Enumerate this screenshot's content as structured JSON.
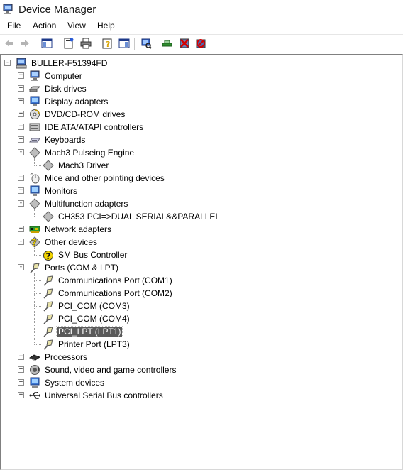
{
  "window": {
    "title": "Device Manager",
    "icon": "device-manager-icon"
  },
  "menu": [
    "File",
    "Action",
    "View",
    "Help"
  ],
  "toolbar": [
    "back-arrow-icon",
    "forward-arrow-icon",
    "show-hide-console-tree-icon",
    "properties-icon",
    "print-icon",
    "help-icon",
    "show-hide-action-pane-icon",
    "scan-hardware-icon",
    "update-driver-icon",
    "disable-device-icon",
    "uninstall-device-icon"
  ],
  "tree": {
    "root": "BULLER-F51394FD",
    "nodes": [
      {
        "label": "Computer",
        "icon": "computer-icon",
        "level": 1,
        "expander": "+"
      },
      {
        "label": "Disk drives",
        "icon": "disk-drive-icon",
        "level": 1,
        "expander": "+"
      },
      {
        "label": "Display adapters",
        "icon": "monitor-icon",
        "level": 1,
        "expander": "+"
      },
      {
        "label": "DVD/CD-ROM drives",
        "icon": "cdrom-icon",
        "level": 1,
        "expander": "+"
      },
      {
        "label": "IDE ATA/ATAPI controllers",
        "icon": "ide-controller-icon",
        "level": 1,
        "expander": "+"
      },
      {
        "label": "Keyboards",
        "icon": "keyboard-icon",
        "level": 1,
        "expander": "+"
      },
      {
        "label": "Mach3 Pulseing Engine",
        "icon": "generic-device-icon",
        "level": 1,
        "expander": "-"
      },
      {
        "label": "Mach3 Driver",
        "icon": "generic-device-icon",
        "level": 2
      },
      {
        "label": "Mice and other pointing devices",
        "icon": "mouse-icon",
        "level": 1,
        "expander": "+"
      },
      {
        "label": "Monitors",
        "icon": "monitor-icon",
        "level": 1,
        "expander": "+"
      },
      {
        "label": "Multifunction adapters",
        "icon": "generic-device-icon",
        "level": 1,
        "expander": "-"
      },
      {
        "label": "CH353 PCI=>DUAL SERIAL&&PARALLEL",
        "icon": "generic-device-icon",
        "level": 2
      },
      {
        "label": "Network adapters",
        "icon": "network-adapter-icon",
        "level": 1,
        "expander": "+"
      },
      {
        "label": "Other devices",
        "icon": "unknown-device-icon",
        "level": 1,
        "expander": "-"
      },
      {
        "label": "SM Bus Controller",
        "icon": "unknown-device-icon",
        "level": 2
      },
      {
        "label": "Ports (COM & LPT)",
        "icon": "port-icon",
        "level": 1,
        "expander": "-"
      },
      {
        "label": "Communications Port (COM1)",
        "icon": "port-icon",
        "level": 2
      },
      {
        "label": "Communications Port (COM2)",
        "icon": "port-icon",
        "level": 2
      },
      {
        "label": "PCI_COM (COM3)",
        "icon": "port-icon",
        "level": 2
      },
      {
        "label": "PCI_COM (COM4)",
        "icon": "port-icon",
        "level": 2
      },
      {
        "label": "PCI_LPT (LPT1)",
        "icon": "port-icon",
        "level": 2,
        "selected": true
      },
      {
        "label": "Printer Port (LPT3)",
        "icon": "port-icon",
        "level": 2
      },
      {
        "label": "Processors",
        "icon": "processor-icon",
        "level": 1,
        "expander": "+"
      },
      {
        "label": "Sound, video and game controllers",
        "icon": "sound-icon",
        "level": 1,
        "expander": "+"
      },
      {
        "label": "System devices",
        "icon": "system-device-icon",
        "level": 1,
        "expander": "+"
      },
      {
        "label": "Universal Serial Bus controllers",
        "icon": "usb-icon",
        "level": 1,
        "expander": "+"
      }
    ]
  }
}
